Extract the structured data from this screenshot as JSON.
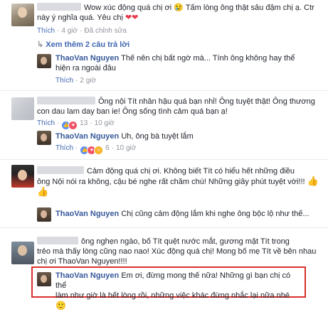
{
  "comments": [
    {
      "text": "Wow xúc động quá chị ơi 😢 Tấm lòng ông thật sâu đậm chị ạ. Ctr này ý nghĩa quá. Yêu chị ❤❤",
      "line1": "Wow xúc động quá chị ơi",
      "line1b": "Tấm lòng ông thật sâu đậm chị ạ. Ctr",
      "line2": "này ý nghĩa quá. Yêu chị",
      "like": "Thích",
      "time": "4 giờ",
      "edited": "Đã chỉnh sửa",
      "view_more": "Xem thêm 2 câu trả lời",
      "reply": {
        "name": "ThaoVan Nguyen",
        "line1": "Thế nên chị bất ngờ mà... Tính ông không hay thể",
        "line2": "hiện ra ngoài đâu",
        "like": "Thích",
        "time": "2 giờ"
      }
    },
    {
      "line1": "Ông nội Tít nhân hậu quá bạn nhỉ! Ông tuyệt thật! Ông thương",
      "line2": "con dau lam day ban ie! Ông sống tình cảm quá bạn ạ!",
      "like": "Thích",
      "count": "13",
      "time": "10 giờ",
      "reply": {
        "name": "ThaoVan Nguyen",
        "line1": "Uh, ông bà tuyệt lắm",
        "like": "Thích",
        "count": "6",
        "time": "10 giờ"
      }
    },
    {
      "line1": "Cảm động quá chị ơi. Không biết Tít có hiểu hết những điều",
      "line2": "ông Nội nói ra không, cậu bé nghe rất chăm chú! Những giây phút tuyệt vời!!!",
      "reply": {
        "name": "ThaoVan Nguyen",
        "line1": "Chị cũng cảm động lắm khi nghe ông bộc lộ như thế..."
      }
    },
    {
      "line1": "ông nghẹn ngào, bố Tít quệt nước mắt, gương mặt Tít trong",
      "line2": "trẻo mà thấy lòng cũng nao nao! Xúc động quá chị! Mong bố mẹ Tít về bên nhau",
      "line3": "chị ơi ThaoVan Nguyen!!!!",
      "reply": {
        "name": "ThaoVan Nguyen",
        "line1": "Em ơi, đừng mong thế nữa! Những gì bạn chị có thể",
        "line2": "làm như giờ là hết lòng rồi, những việc khác đừng nhắc lại nữa nhé"
      }
    }
  ],
  "colors": {
    "link": "#365899",
    "meta": "#90949c",
    "highlight": "#d9302c"
  }
}
